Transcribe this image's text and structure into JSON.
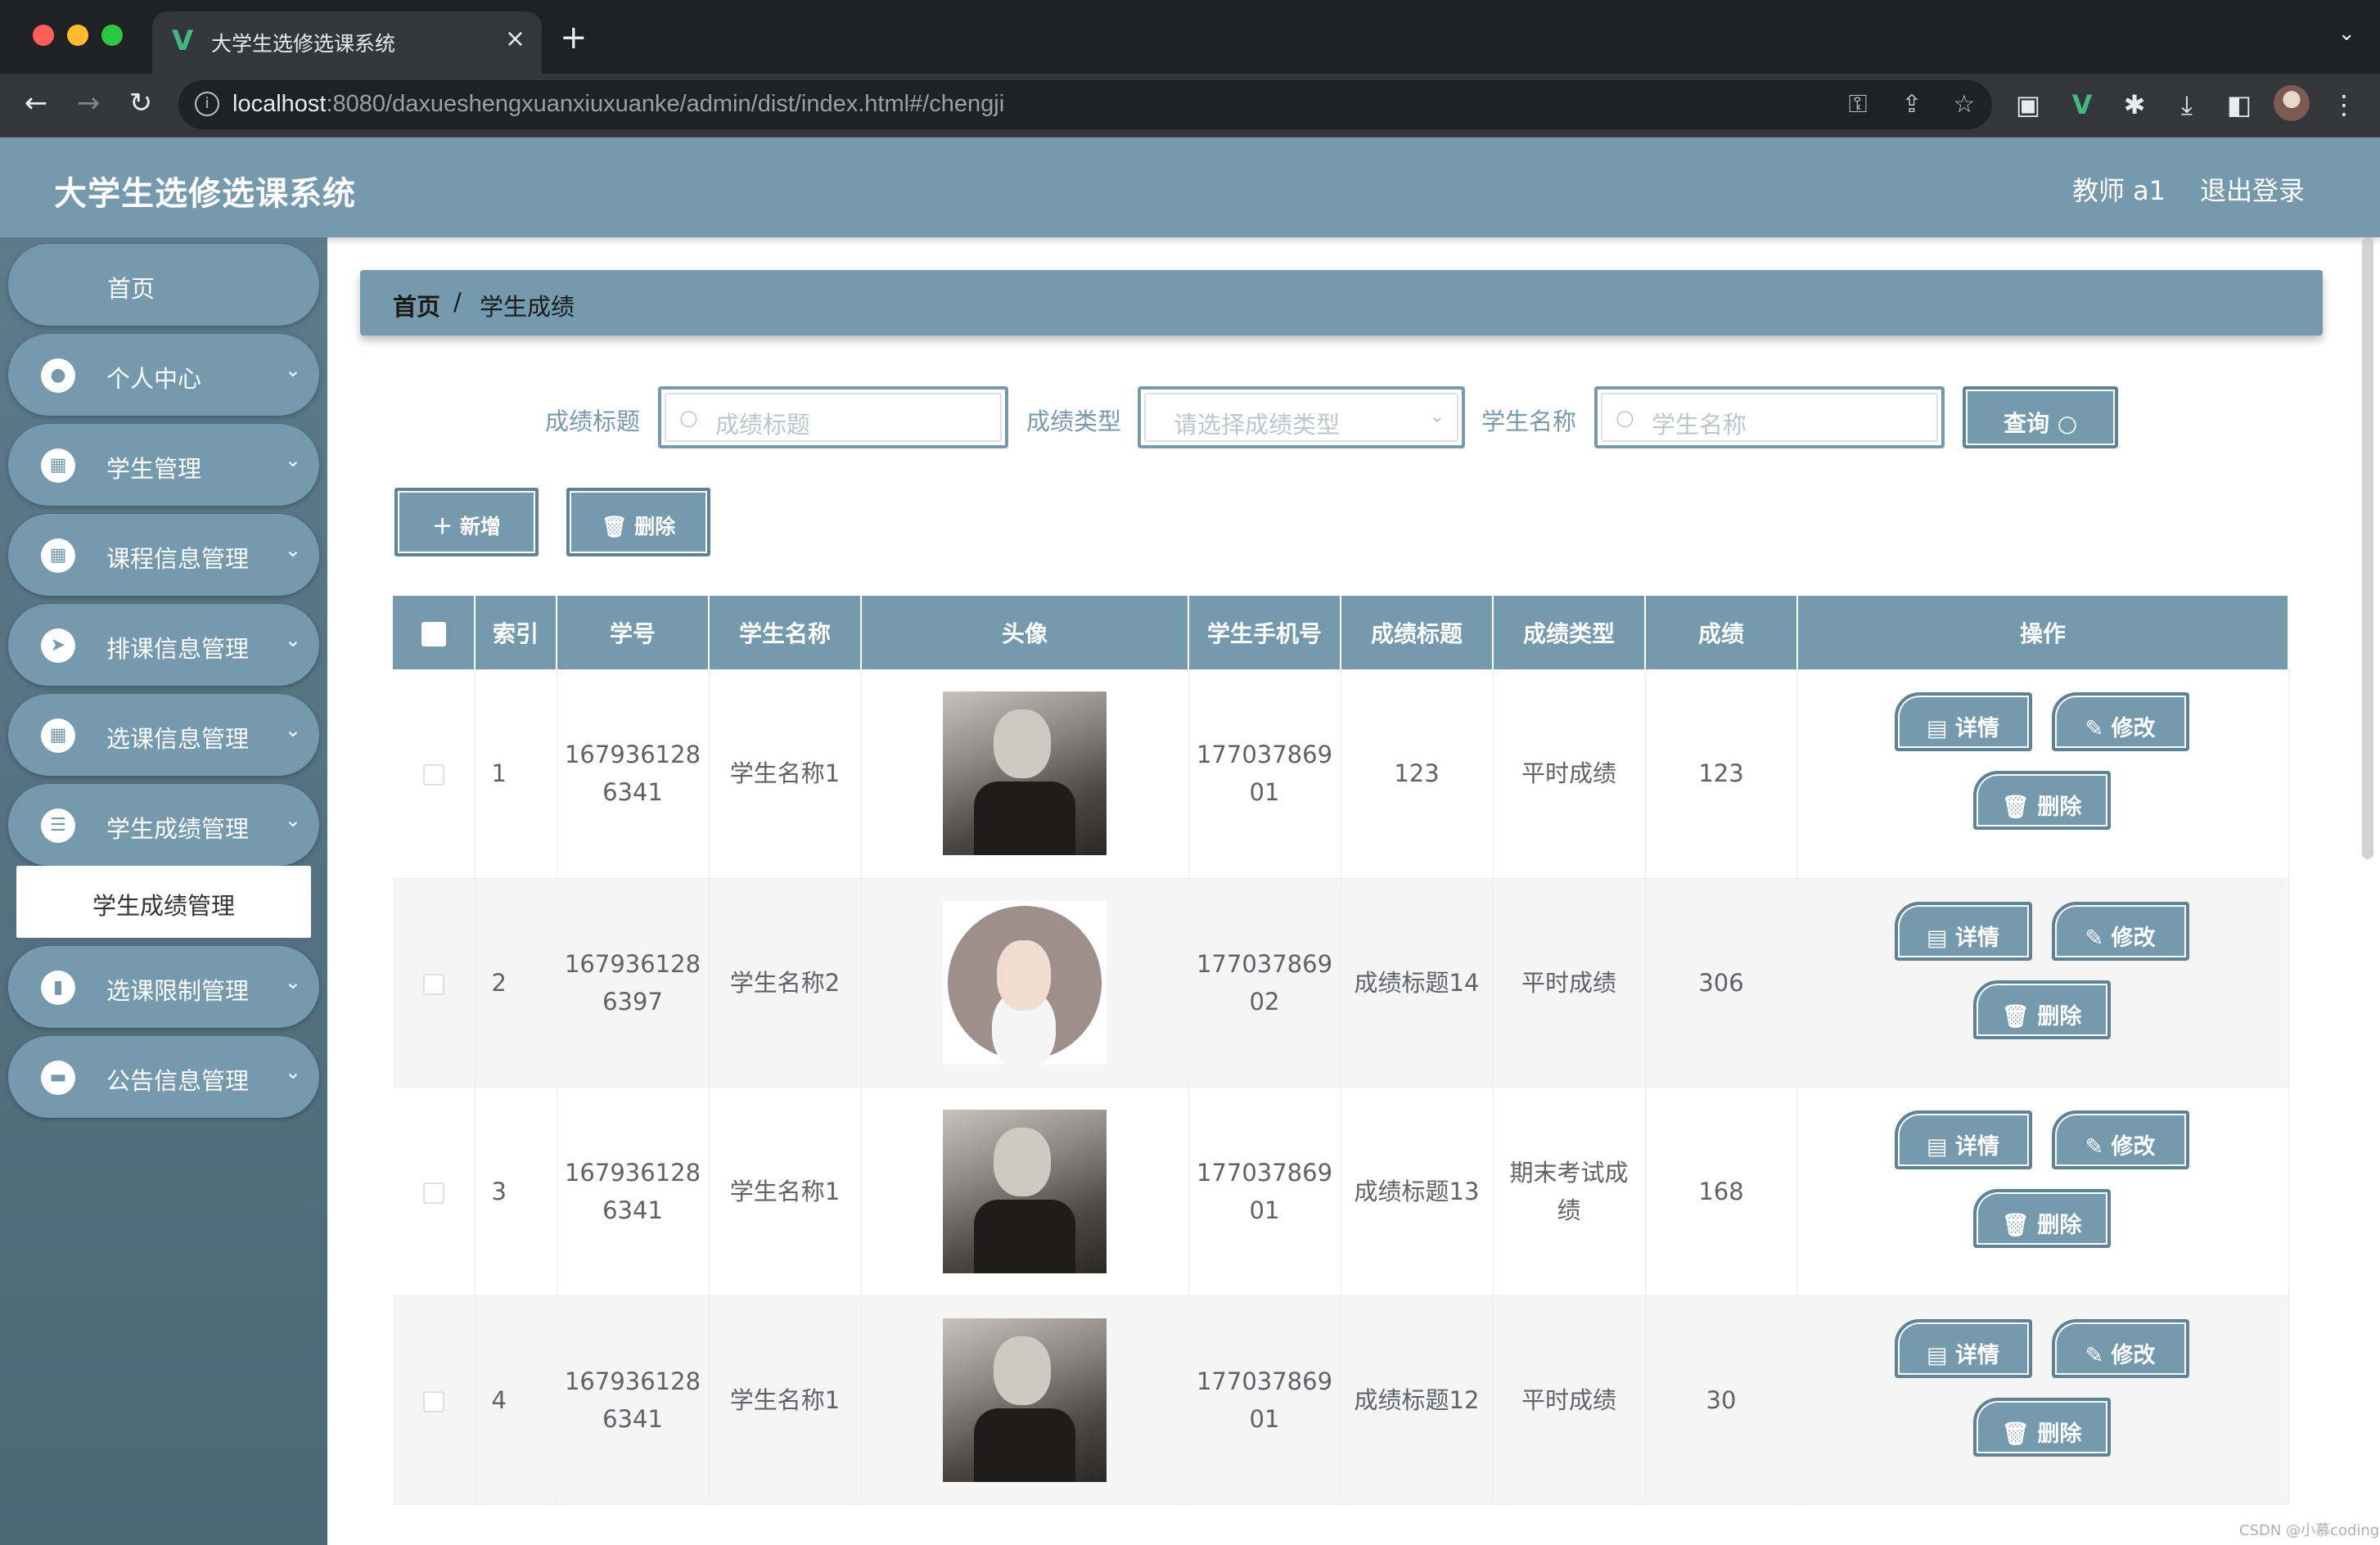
{
  "browser": {
    "tab_title": "大学生选修选课系统",
    "tab_close": "×",
    "new_tab": "+",
    "url_host": "localhost",
    "url_rest": ":8080/daxueshengxuanxiuxuanke/admin/dist/index.html#/chengji"
  },
  "header": {
    "title": "大学生选修选课系统",
    "user": "教师 a1",
    "logout": "退出登录"
  },
  "sidebar": {
    "items": [
      {
        "label": "首页",
        "icon": "home"
      },
      {
        "label": "个人中心",
        "icon": "user-icon"
      },
      {
        "label": "学生管理",
        "icon": "grid-icon"
      },
      {
        "label": "课程信息管理",
        "icon": "grid-icon"
      },
      {
        "label": "排课信息管理",
        "icon": "send-icon"
      },
      {
        "label": "选课信息管理",
        "icon": "grid-icon"
      },
      {
        "label": "学生成绩管理",
        "icon": "list-icon"
      },
      {
        "label": "选课限制管理",
        "icon": "chart-icon"
      },
      {
        "label": "公告信息管理",
        "icon": "inbox-icon"
      }
    ],
    "submenu_active": "学生成绩管理"
  },
  "breadcrumb": {
    "home": "首页",
    "sep": "/",
    "current": "学生成绩"
  },
  "search": {
    "title_label": "成绩标题",
    "title_placeholder": "成绩标题",
    "type_label": "成绩类型",
    "type_placeholder": "请选择成绩类型",
    "name_label": "学生名称",
    "name_placeholder": "学生名称",
    "query_button": "查询 ○"
  },
  "actions": {
    "add": "＋ 新增",
    "delete": "🗑 删除"
  },
  "table": {
    "headers": [
      "",
      "索引",
      "学号",
      "学生名称",
      "头像",
      "学生手机号",
      "成绩标题",
      "成绩类型",
      "成绩",
      "操作"
    ],
    "rows": [
      {
        "index": "1",
        "student_no": "1679361286341",
        "name": "学生名称1",
        "avatar": "man",
        "phone": "17703786901",
        "title": "123",
        "type": "平时成绩",
        "score": "123"
      },
      {
        "index": "2",
        "student_no": "1679361286397",
        "name": "学生名称2",
        "avatar": "girl",
        "phone": "17703786902",
        "title": "成绩标题14",
        "type": "平时成绩",
        "score": "306"
      },
      {
        "index": "3",
        "student_no": "1679361286341",
        "name": "学生名称1",
        "avatar": "man",
        "phone": "17703786901",
        "title": "成绩标题13",
        "type": "期末考试成绩",
        "score": "168"
      },
      {
        "index": "4",
        "student_no": "1679361286341",
        "name": "学生名称1",
        "avatar": "man",
        "phone": "17703786901",
        "title": "成绩标题12",
        "type": "平时成绩",
        "score": "30"
      }
    ],
    "op_detail": "详情",
    "op_edit": "修改",
    "op_delete": "删除"
  },
  "watermark": "CSDN @小慕coding",
  "colors": {
    "primary": "#7599ad",
    "sidebar": "#5b7a8a"
  }
}
